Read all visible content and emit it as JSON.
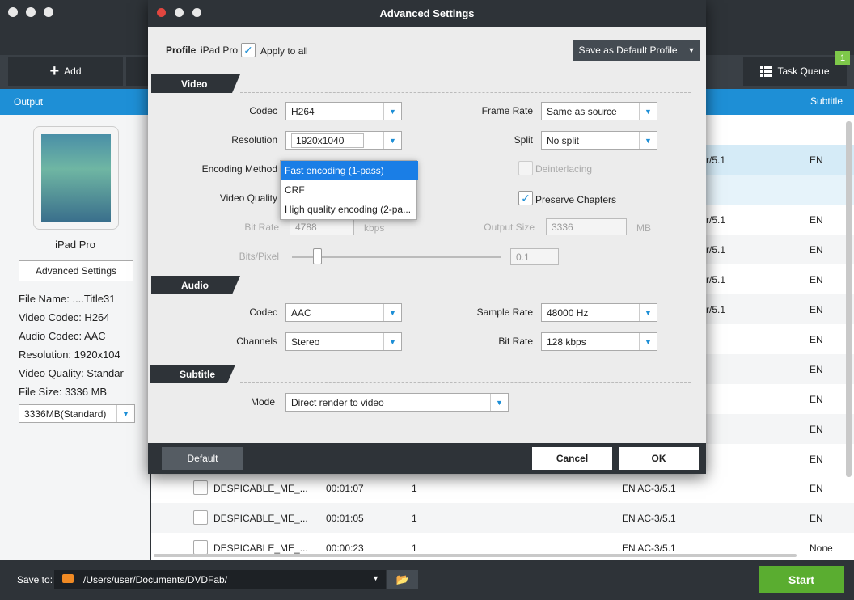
{
  "main": {
    "toolbar": {
      "add_label": "Add",
      "task_queue_label": "Task Queue",
      "task_queue_badge": "1"
    },
    "header": {
      "output_label": "Output",
      "subtitle_label": "Subtitle"
    },
    "profile_panel": {
      "device_label": "iPad Pro",
      "advanced_settings_label": "Advanced Settings",
      "info": [
        "File Name: ....Title31",
        "Video Codec: H264",
        "Audio Codec: AAC",
        "Resolution: 1920x104",
        "Video Quality: Standar",
        "File Size: 3336 MB"
      ],
      "size_select": "3336MB(Standard)"
    },
    "background_rows": [
      {
        "audio": "r/5.1",
        "subtitle": "EN",
        "highlight": true
      },
      {
        "audio": "",
        "subtitle": "",
        "highlight": true
      },
      {
        "audio": "r/5.1",
        "subtitle": "EN"
      },
      {
        "audio": "r/5.1",
        "subtitle": "EN"
      },
      {
        "audio": "r/5.1",
        "subtitle": "EN"
      },
      {
        "audio": "r/5.1",
        "subtitle": "EN"
      },
      {
        "audio": "",
        "subtitle": "EN"
      },
      {
        "audio": "",
        "subtitle": "EN"
      },
      {
        "audio": "",
        "subtitle": "EN"
      },
      {
        "audio": "",
        "subtitle": "EN"
      },
      {
        "audio": "",
        "subtitle": "EN"
      }
    ],
    "title_rows": [
      {
        "name": "DESPICABLE_ME_...",
        "duration": "00:01:07",
        "chapters": "1",
        "audio": "EN  AC-3/5.1",
        "subtitle": "EN"
      },
      {
        "name": "DESPICABLE_ME_...",
        "duration": "00:01:05",
        "chapters": "1",
        "audio": "EN  AC-3/5.1",
        "subtitle": "EN"
      },
      {
        "name": "DESPICABLE_ME_...",
        "duration": "00:00:23",
        "chapters": "1",
        "audio": "EN  AC-3/5.1",
        "subtitle": "None"
      }
    ],
    "footer": {
      "save_to_label": "Save to:",
      "path": "/Users/user/Documents/DVDFab/",
      "start_label": "Start"
    }
  },
  "dialog": {
    "title": "Advanced Settings",
    "profile_label": "Profile",
    "profile_value": "iPad Pro",
    "apply_to_all_label": "Apply to all",
    "save_default_label": "Save as Default Profile",
    "video": {
      "section_label": "Video",
      "codec_label": "Codec",
      "codec_value": "H264",
      "resolution_label": "Resolution",
      "resolution_value": "1920x1040",
      "encoding_method_label": "Encoding Method",
      "video_quality_label": "Video Quality",
      "bit_rate_label": "Bit Rate",
      "bit_rate_value": "4788",
      "bit_rate_unit": "kbps",
      "bits_pixel_label": "Bits/Pixel",
      "bits_pixel_value": "0.1",
      "bits_pixel_slider": 0.12,
      "frame_rate_label": "Frame Rate",
      "frame_rate_value": "Same as source",
      "split_label": "Split",
      "split_value": "No split",
      "deinterlacing_label": "Deinterlacing",
      "preserve_chapters_label": "Preserve Chapters",
      "output_size_label": "Output Size",
      "output_size_value": "3336",
      "output_size_unit": "MB"
    },
    "encoding_options": [
      "Fast encoding (1-pass)",
      "CRF",
      "High quality encoding (2-pa..."
    ],
    "audio": {
      "section_label": "Audio",
      "codec_label": "Codec",
      "codec_value": "AAC",
      "channels_label": "Channels",
      "channels_value": "Stereo",
      "sample_rate_label": "Sample Rate",
      "sample_rate_value": "48000 Hz",
      "bit_rate_label": "Bit Rate",
      "bit_rate_value": "128 kbps"
    },
    "subtitle": {
      "section_label": "Subtitle",
      "mode_label": "Mode",
      "mode_value": "Direct render to video"
    },
    "buttons": {
      "default_label": "Default",
      "cancel_label": "Cancel",
      "ok_label": "OK"
    }
  },
  "colors": {
    "accent": "#1e8fd6",
    "start": "#5aad30",
    "dark": "#2e3338"
  }
}
